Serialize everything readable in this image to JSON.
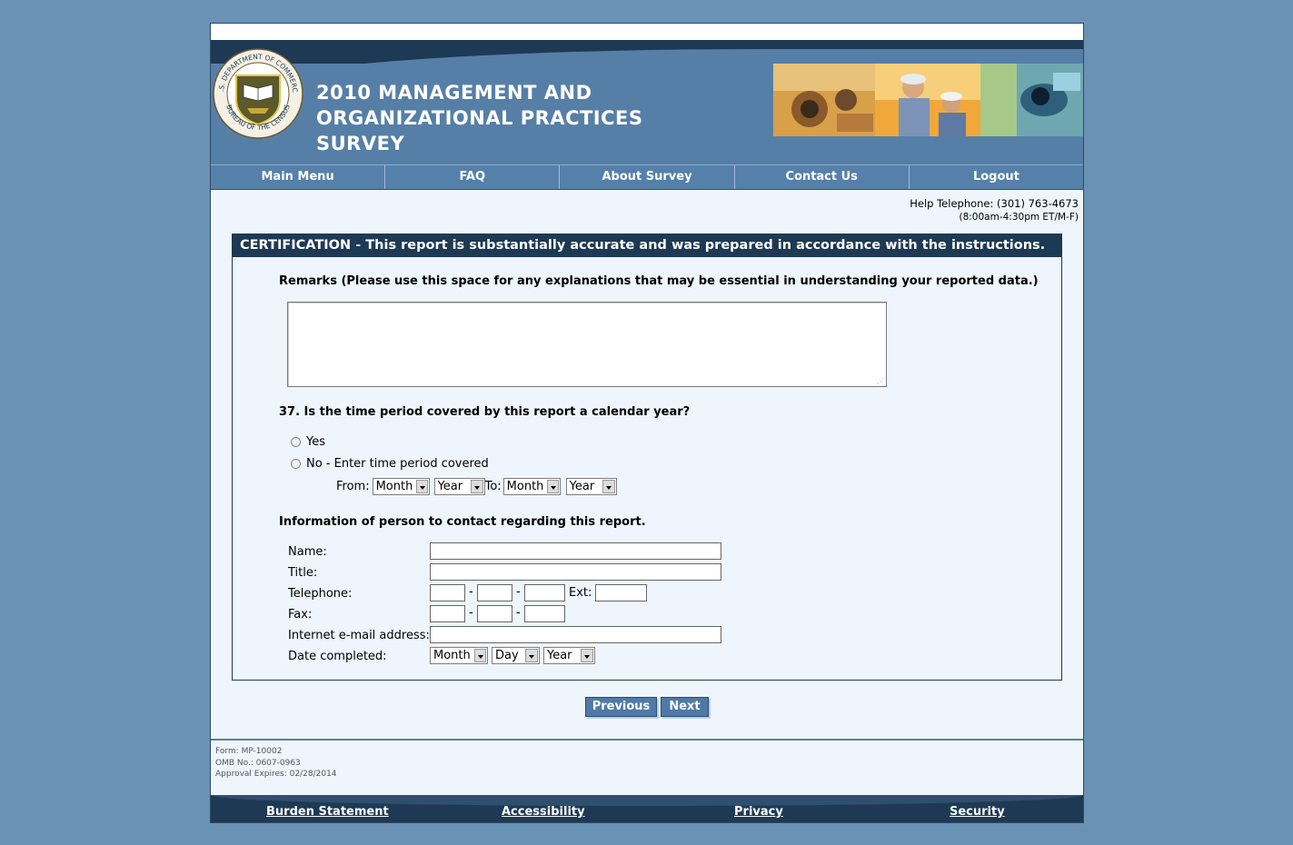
{
  "header": {
    "seal_text_top": "U.S. DEPARTMENT OF COMMERCE",
    "seal_text_bottom": "BUREAU OF THE CENSUS",
    "title_line1": "2010 MANAGEMENT AND",
    "title_line2": "ORGANIZATIONAL PRACTICES",
    "title_line3": "SURVEY"
  },
  "nav": [
    {
      "label": "Main Menu"
    },
    {
      "label": "FAQ"
    },
    {
      "label": "About Survey"
    },
    {
      "label": "Contact Us"
    },
    {
      "label": "Logout"
    }
  ],
  "help": {
    "telephone": "Help Telephone: (301) 763-4673",
    "hours": "(8:00am-4:30pm ET/M-F)"
  },
  "certification": {
    "heading_label": "CERTIFICATION",
    "heading_sep": " - ",
    "heading_text": "This report is substantially accurate and was prepared in accordance with the instructions."
  },
  "remarks": {
    "label": "Remarks (Please use this space for any explanations that may be essential in understanding your reported data.)",
    "value": ""
  },
  "question37": {
    "label": "37. Is the time period covered by this report a calendar year?",
    "option_yes": "Yes",
    "option_no": "No - Enter time period covered",
    "from_label": "From:",
    "to_label": "To:",
    "from_month": "Month",
    "from_year": "Year",
    "to_month": "Month",
    "to_year": "Year"
  },
  "contact": {
    "heading": "Information of person to contact regarding this report.",
    "name_label": "Name:",
    "title_label": "Title:",
    "telephone_label": "Telephone:",
    "ext_label": "Ext:",
    "fax_label": "Fax:",
    "email_label": "Internet e-mail address:",
    "date_label": "Date completed:",
    "date_month": "Month",
    "date_day": "Day",
    "date_year": "Year",
    "dash": "-"
  },
  "buttons": {
    "previous": "Previous",
    "next": "Next"
  },
  "form_meta": {
    "form": "Form: MP-10002",
    "omb": "OMB No.: 0607-0963",
    "expires": "Approval Expires: 02/28/2014"
  },
  "footer": [
    {
      "label": "Burden Statement"
    },
    {
      "label": "Accessibility"
    },
    {
      "label": "Privacy"
    },
    {
      "label": "Security"
    }
  ],
  "colors": {
    "page_background": "#6a92b5",
    "header_blue": "#567fa7",
    "dark_navy": "#1e3954",
    "content_background": "#eef5fc"
  }
}
